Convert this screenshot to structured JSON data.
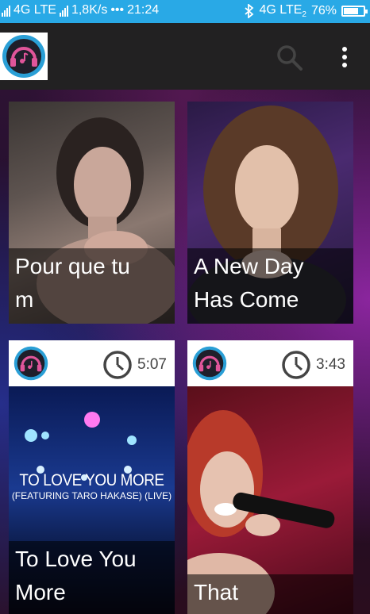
{
  "status_bar": {
    "left_network": "4G LTE",
    "speed": "1,8K/s",
    "dots": "•••",
    "time": "21:24",
    "right_network": "4G LTE",
    "right_network_sub": "2",
    "battery_percent": "76%",
    "battery_level": 0.76,
    "color": "#29a9e6"
  },
  "app_bar": {
    "logo_icon": "headphones-music-logo",
    "search_icon": "search-icon",
    "menu_icon": "more-vertical-icon"
  },
  "cards": [
    {
      "caption_lines": [
        "Pour que tu",
        "m"
      ],
      "has_header": false,
      "thumbnail": "woman-dark-hair-portrait"
    },
    {
      "caption_lines": [
        "A New Day",
        "Has Come"
      ],
      "has_header": false,
      "thumbnail": "woman-curly-hair-portrait"
    },
    {
      "caption_lines": [
        "To Love You",
        "More"
      ],
      "has_header": true,
      "duration": "5:07",
      "thumbnail_title": "TO LOVE YOU MORE",
      "thumbnail_subtitle": "(FEATURING TARO HAKASE) (LIVE)"
    },
    {
      "caption_lines": [
        "That"
      ],
      "has_header": true,
      "duration": "3:43",
      "thumbnail": "singer-with-microphone"
    }
  ]
}
